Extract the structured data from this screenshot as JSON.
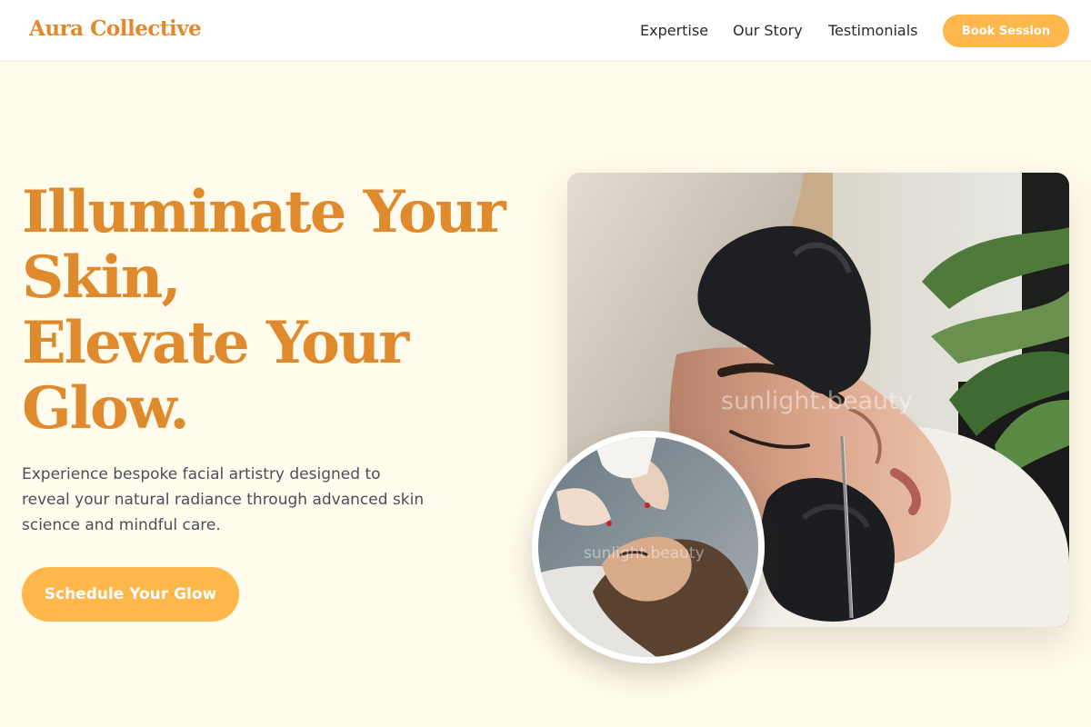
{
  "brand": {
    "name": "Aura Collective"
  },
  "nav": {
    "items": [
      "Expertise",
      "Our Story",
      "Testimonials"
    ],
    "book_label": "Book Session"
  },
  "hero": {
    "headline_lines": [
      "Illuminate Your",
      "Skin,",
      "Elevate Your",
      "Glow."
    ],
    "subtext": "Experience bespoke facial artistry designed to reveal your natural radiance through advanced skin science and mindful care.",
    "cta_label": "Schedule Your Glow"
  },
  "images": {
    "main_watermark": "sunlight.beauty",
    "inset_watermark": "sunlight.beauty"
  },
  "colors": {
    "accent": "#e08a2e",
    "button": "#fdb74a",
    "background": "#fffbed"
  }
}
